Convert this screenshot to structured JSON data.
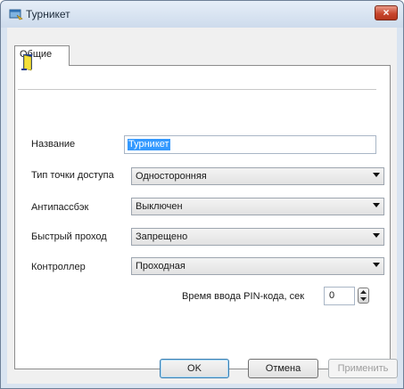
{
  "window": {
    "title": "Турникет",
    "close_symbol": "×"
  },
  "tabs": [
    {
      "label": "Общие",
      "active": true
    }
  ],
  "icons": {
    "app": "window-icon",
    "door": "door-icon"
  },
  "form": {
    "name": {
      "label": "Название",
      "value": "Турникет"
    },
    "access_point_type": {
      "label": "Тип точки доступа",
      "value": "Односторонняя"
    },
    "antipassback": {
      "label": "Антипассбэк",
      "value": "Выключен"
    },
    "fast_pass": {
      "label": "Быстрый проход",
      "value": "Запрещено"
    },
    "controller": {
      "label": "Контроллер",
      "value": "Проходная"
    },
    "pin_timeout": {
      "label": "Время ввода PIN-кода, сек",
      "value": "0"
    }
  },
  "buttons": {
    "ok": "OK",
    "cancel": "Отмена",
    "apply": "Применить"
  },
  "colors": {
    "title_gradient_top": "#e6eef8",
    "close_button": "#c8462d",
    "selection": "#3399ff",
    "dialog_bg": "#f0f0f0"
  }
}
